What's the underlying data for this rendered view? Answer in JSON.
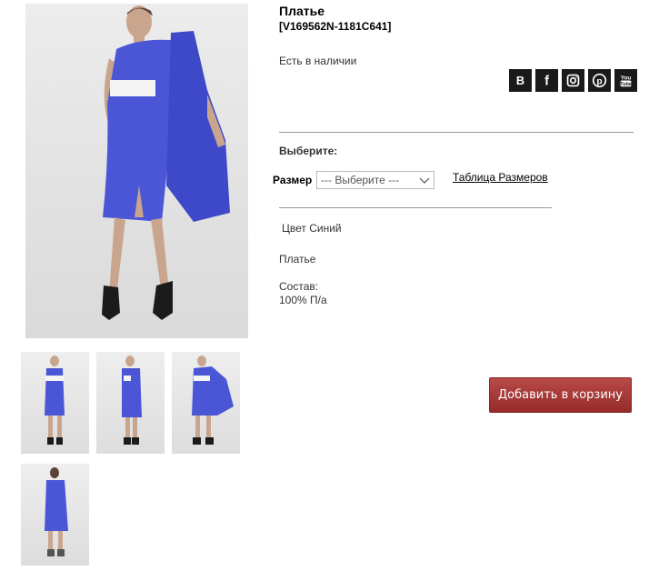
{
  "product": {
    "title": "Платье",
    "sku": "[V169562N-1181C641]",
    "stock_status": "Есть в наличии",
    "choose_label": "Выберите:",
    "size_label": "Размер",
    "size_select_value": "--- Выберите ---",
    "size_table_link": "Таблица Размеров",
    "color_text": "Цвет Синий",
    "description": "Платье",
    "composition_label": "Состав:",
    "composition_value": "100% П/а",
    "add_to_cart_label": "Добавить в корзину"
  },
  "social": [
    {
      "icon": "vk-icon",
      "glyph": "B"
    },
    {
      "icon": "facebook-icon",
      "glyph": "f"
    },
    {
      "icon": "instagram-icon",
      "glyph": ""
    },
    {
      "icon": "pinterest-icon",
      "glyph": ""
    },
    {
      "icon": "youtube-icon",
      "glyph": ""
    }
  ],
  "images": {
    "main": "product-photo-main",
    "thumbnails": [
      "thumbnail-front",
      "thumbnail-side",
      "thumbnail-cape",
      "thumbnail-back"
    ]
  },
  "colors": {
    "dress_blue": "#4a56d6",
    "button_red": "#a83836",
    "social_bg": "#1a1a1a"
  }
}
